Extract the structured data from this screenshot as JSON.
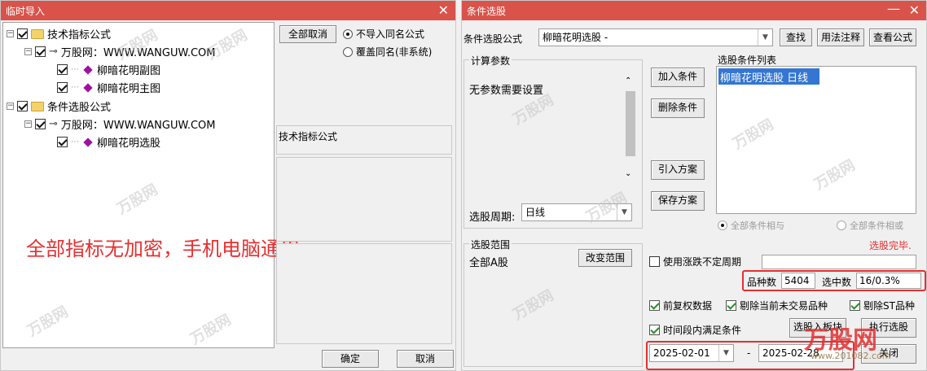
{
  "import_window": {
    "title": "临时导入",
    "tree": [
      {
        "label": "技术指标公式",
        "level": 0,
        "type": "folder"
      },
      {
        "label": "万股网：WWW.WANGUW.COM",
        "level": 1,
        "type": "key"
      },
      {
        "label": "柳暗花明副图",
        "level": 2,
        "type": "item"
      },
      {
        "label": "柳暗花明主图",
        "level": 2,
        "type": "item"
      },
      {
        "label": "条件选股公式",
        "level": 0,
        "type": "folder"
      },
      {
        "label": "万股网：WWW.WANGUW.COM",
        "level": 1,
        "type": "key"
      },
      {
        "label": "柳暗花明选股",
        "level": 2,
        "type": "item"
      }
    ],
    "cancel_all_label": "全部取消",
    "radio_no_import": "不导入同名公式",
    "radio_overwrite": "覆盖同名(非系统)",
    "section_label": "技术指标公式",
    "overlay_text": "全部指标无加密，手机电脑通用",
    "ok_label": "确定",
    "cancel_label": "取消"
  },
  "select_window": {
    "title": "条件选股",
    "formula_label": "条件选股公式",
    "formula_value": "柳暗花明选股  -",
    "find_label": "查找",
    "usage_label": "用法注释",
    "view_label": "查看公式",
    "params_caption": "计算参数",
    "params_text": "无参数需要设置",
    "period_label": "选股周期:",
    "period_value": "日线",
    "add_cond_label": "加入条件",
    "del_cond_label": "删除条件",
    "import_plan_label": "引入方案",
    "save_plan_label": "保存方案",
    "list_caption": "选股条件列表",
    "list_items": [
      "柳暗花明选股  日线"
    ],
    "radio_and": "全部条件相与",
    "radio_or": "全部条件相或",
    "status_text": "选股完毕.",
    "range_caption": "选股范围",
    "range_value": "全部A股",
    "change_range_label": "改变范围",
    "use_limit_label": "使用涨跌不定周期",
    "stock_count_label": "品种数",
    "stock_count_value": "5404",
    "selected_label": "选中数",
    "selected_value": "16/0.3%",
    "rights_label": "前复权数据",
    "exclude_untraded_label": "剔除当前未交易品种",
    "exclude_st_label": "剔除ST品种",
    "within_period_label": "时间段内满足条件",
    "to_board_label": "选股入板块",
    "execute_label": "执行选股",
    "date_from": "2025-02-01",
    "date_sep": "-",
    "date_to": "2025-02-28",
    "close_label": "关闭"
  },
  "watermarks": {
    "brand": "万股网",
    "url": "www.201082.com"
  },
  "colors": {
    "title_bar": "#d9534a",
    "accent_red": "#e53030",
    "selection": "#3476d2"
  }
}
